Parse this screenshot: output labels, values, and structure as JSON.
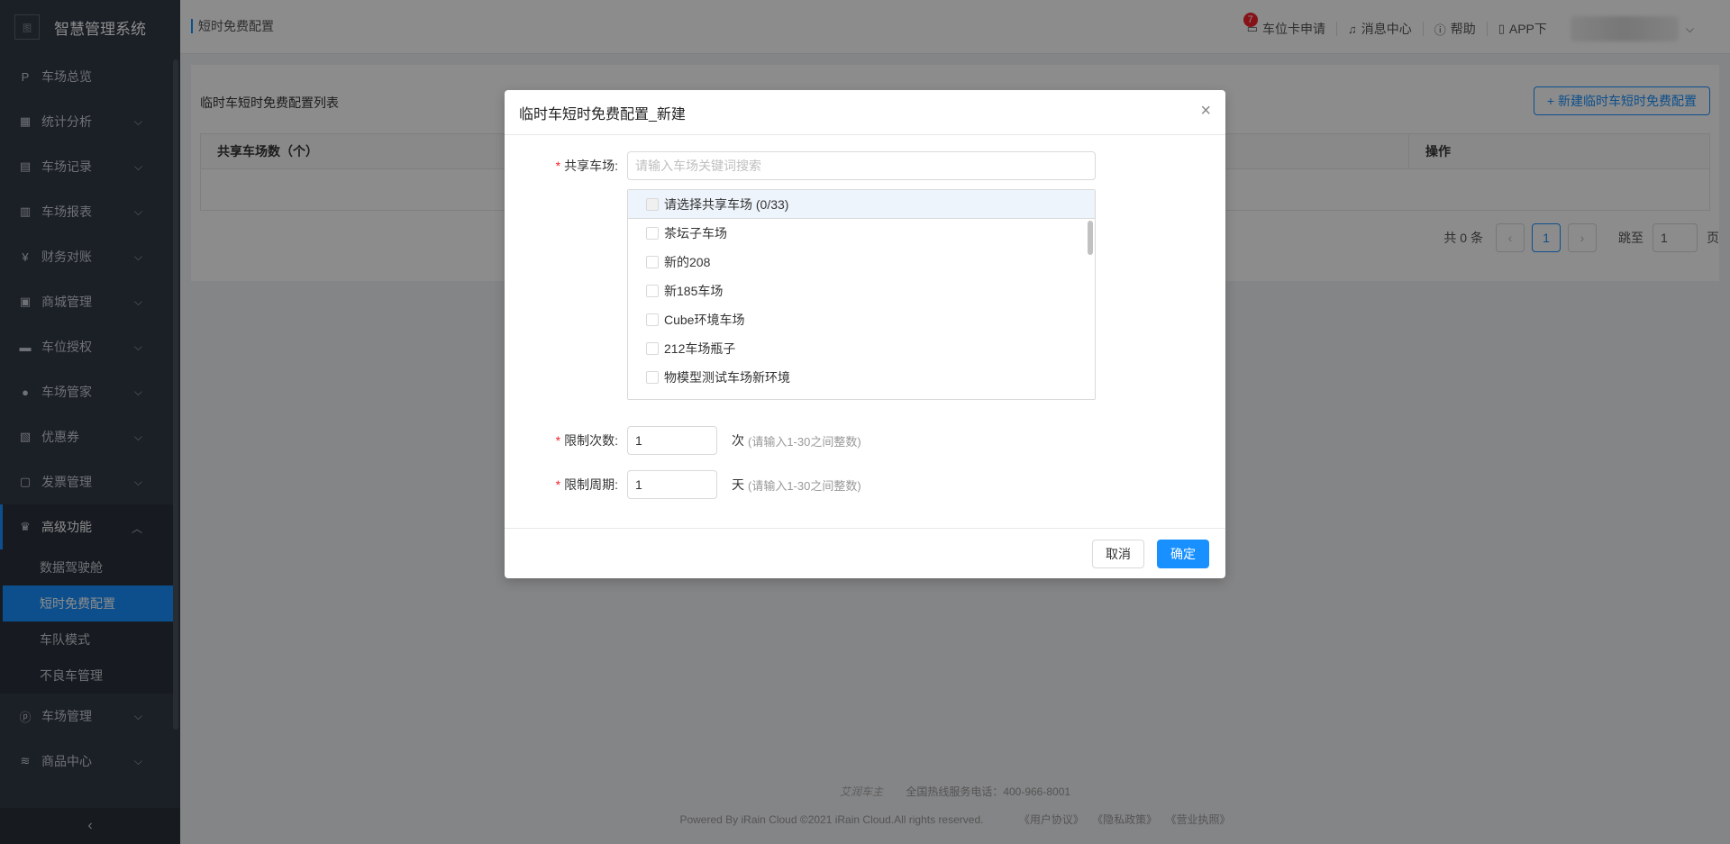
{
  "app": {
    "title": "智慧管理系统",
    "logo_alt": "图"
  },
  "sidebar": {
    "items": [
      {
        "label": "车场总览",
        "icon": "parking-icon",
        "glyph": "P"
      },
      {
        "label": "统计分析",
        "icon": "chart-icon",
        "glyph": "▦"
      },
      {
        "label": "车场记录",
        "icon": "record-icon",
        "glyph": "▤"
      },
      {
        "label": "车场报表",
        "icon": "report-icon",
        "glyph": "▥"
      },
      {
        "label": "财务对账",
        "icon": "finance-icon",
        "glyph": "¥"
      },
      {
        "label": "商城管理",
        "icon": "shop-icon",
        "glyph": "▣"
      },
      {
        "label": "车位授权",
        "icon": "car-icon",
        "glyph": "▬"
      },
      {
        "label": "车场管家",
        "icon": "user-icon",
        "glyph": "●"
      },
      {
        "label": "优惠券",
        "icon": "coupon-icon",
        "glyph": "▧"
      },
      {
        "label": "发票管理",
        "icon": "invoice-icon",
        "glyph": "▢"
      },
      {
        "label": "高级功能",
        "icon": "crown-icon",
        "glyph": "♛"
      }
    ],
    "sub_items": [
      {
        "label": "数据驾驶舱"
      },
      {
        "label": "短时免费配置"
      },
      {
        "label": "车队模式"
      },
      {
        "label": "不良车管理"
      }
    ],
    "after_items": [
      {
        "label": "车场管理",
        "icon": "manage-icon",
        "glyph": "ⓟ"
      },
      {
        "label": "商品中心",
        "icon": "layers-icon",
        "glyph": "≋"
      }
    ],
    "collapse_glyph": "‹"
  },
  "header": {
    "breadcrumb": "短时免费配置",
    "links": {
      "card_apply": "车位卡申请",
      "card_badge": "7",
      "messages": "消息中心",
      "help": "帮助",
      "app_download": "APP下"
    }
  },
  "content": {
    "list_title": "临时车短时免费配置列表",
    "new_button": "+ 新建临时车短时免费配置",
    "table_headers": {
      "col1": "共享车场数（个）",
      "op": "操作"
    },
    "pager": {
      "total": "共 0 条",
      "prev": "‹",
      "page": "1",
      "next": "›",
      "goto": "跳至",
      "goto_value": "1",
      "page_unit": "页"
    }
  },
  "footer": {
    "brand": "艾润车主",
    "hotline": "全国热线服务电话：400-966-8001",
    "copyright": "Powered By iRain Cloud ©2021 iRain Cloud.All rights reserved.",
    "links": [
      "《用户协议》",
      "《隐私政策》",
      "《营业执照》"
    ]
  },
  "modal": {
    "title": "临时车短时免费配置_新建",
    "close_glyph": "×",
    "shared_label": "共享车场:",
    "search_placeholder": "请输入车场关键词搜索",
    "select_header": "请选择共享车场 (0/33)",
    "options": [
      "茶坛子车场",
      "新的208",
      "新185车场",
      "Cube环境车场",
      "212车场瓶子",
      "物模型测试车场新环境"
    ],
    "limit_count_label": "限制次数:",
    "limit_count_value": "1",
    "limit_count_unit": "次",
    "limit_count_hint": "(请输入1-30之间整数)",
    "limit_period_label": "限制周期:",
    "limit_period_value": "1",
    "limit_period_unit": "天",
    "limit_period_hint": "(请输入1-30之间整数)",
    "cancel": "取消",
    "ok": "确定"
  },
  "colors": {
    "primary": "#1890ff",
    "sidebar_bg": "#323a45",
    "danger": "#f5222d"
  }
}
